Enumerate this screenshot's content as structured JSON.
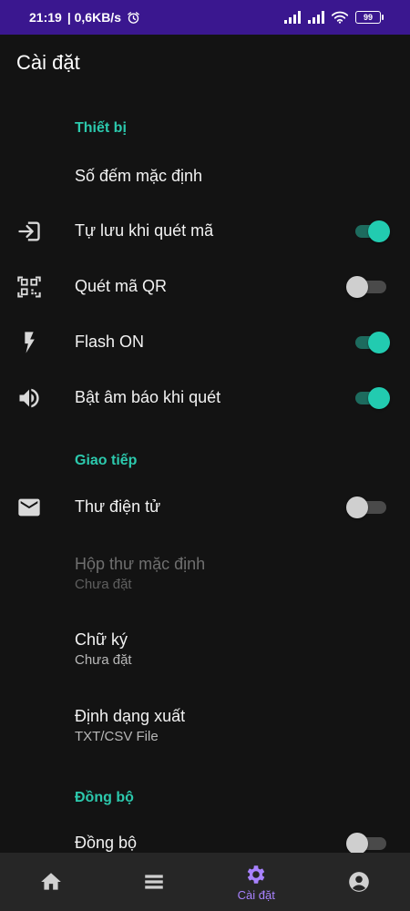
{
  "status_bar": {
    "time": "21:19",
    "network_speed": "| 0,6KB/s",
    "battery": "99"
  },
  "app_title": "Cài đặt",
  "sections": {
    "device": {
      "header": "Thiết bị",
      "default_count": "Số đếm mặc định",
      "autosave": {
        "label": "Tự lưu khi quét mã",
        "on": true
      },
      "qr_scan": {
        "label": "Quét mã QR",
        "on": false
      },
      "flash": {
        "label": "Flash ON",
        "on": true
      },
      "sound": {
        "label": "Bật âm báo khi quét",
        "on": true
      }
    },
    "communication": {
      "header": "Giao tiếp",
      "email": {
        "label": "Thư điện tử",
        "on": false
      },
      "default_mailbox": {
        "label": "Hộp thư mặc định",
        "sub": "Chưa đặt"
      },
      "signature": {
        "label": "Chữ ký",
        "sub": "Chưa đặt"
      },
      "export_format": {
        "label": "Định dạng xuất",
        "sub": "TXT/CSV File"
      }
    },
    "sync": {
      "header": "Đồng bộ",
      "sync_toggle": {
        "label": "Đồng bộ",
        "on": false
      }
    }
  },
  "bottom_nav": {
    "items": [
      {
        "icon": "home-icon",
        "label": ""
      },
      {
        "icon": "menu-icon",
        "label": ""
      },
      {
        "icon": "gear-icon",
        "label": "Cài đặt",
        "active": true
      },
      {
        "icon": "account-icon",
        "label": ""
      }
    ]
  },
  "colors": {
    "status_bar_bg": "#3a178f",
    "background": "#131313",
    "accent_teal": "#2cc9ad",
    "switch_on_thumb": "#22cbb0",
    "nav_active": "#a882ff",
    "bottom_nav_bg": "#262626"
  }
}
